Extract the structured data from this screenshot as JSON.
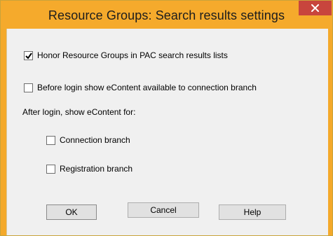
{
  "window": {
    "title": "Resource Groups: Search results settings",
    "close_symbol": "close-icon",
    "accent_color": "#f5aa2c",
    "close_color": "#c8453d"
  },
  "options": {
    "honor_groups": {
      "label": "Honor Resource Groups in PAC search results lists",
      "checked": true
    },
    "before_login": {
      "label": "Before login show eContent available to connection branch",
      "checked": false
    },
    "after_login_heading": "After login, show eContent for:",
    "connection_branch": {
      "label": "Connection branch",
      "checked": false
    },
    "registration_branch": {
      "label": "Registration branch",
      "checked": false
    }
  },
  "buttons": {
    "ok": "OK",
    "cancel": "Cancel",
    "help": "Help"
  }
}
